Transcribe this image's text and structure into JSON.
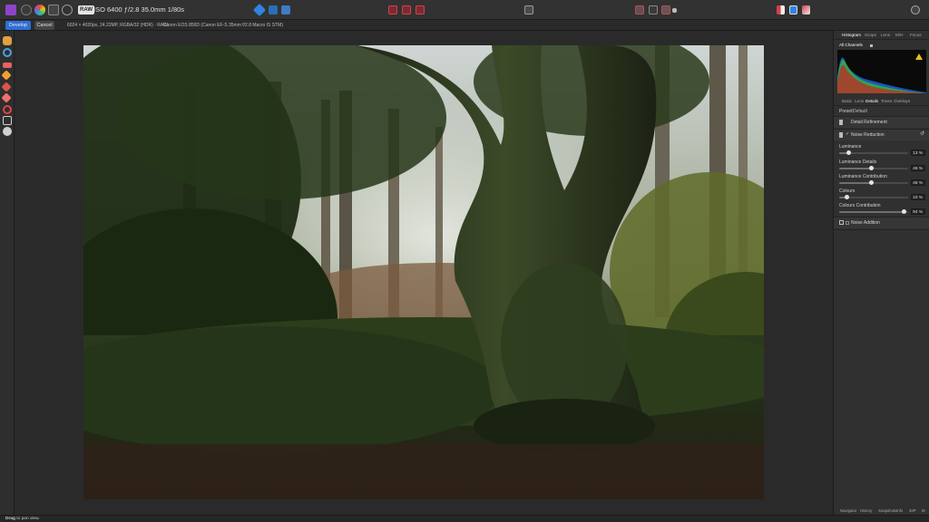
{
  "toolbar": {
    "raw_badge": "RAW",
    "exif": "ISO 6400 ƒ/2.8 35.0mm 1/80s",
    "colors": {
      "persona_develop": "#8e44c9",
      "accent_blue": "#2f84e0",
      "accent_red": "#d6404a"
    }
  },
  "context": {
    "develop_label": "Develop",
    "cancel_label": "Cancel",
    "image_info": "6024 × 4020px, 24.22MP, RGBA/32 (HDR) · RAW",
    "camera_info": "Canon EOS 850D (Canon EF-S 35mm f/2.8 Macro IS STM)"
  },
  "panel": {
    "top_tabs": [
      "Histogram",
      "Scope",
      "Lens",
      "M/H",
      "Focus"
    ],
    "channels": "All Channels",
    "sub_tabs": [
      "Basic",
      "Lens",
      "Details",
      "Tones",
      "Overlays"
    ],
    "preset_label": "Preset:",
    "preset_value": "Default",
    "detail_refinement": "Detail Refinement",
    "noise_reduction": "Noise Reduction",
    "sliders": [
      {
        "label": "Luminance",
        "value_text": "13 %",
        "value": 13
      },
      {
        "label": "Luminance Details",
        "value_text": "46 %",
        "value": 46
      },
      {
        "label": "Luminance Contribution",
        "value_text": "46 %",
        "value": 46
      },
      {
        "label": "Colours",
        "value_text": "10 %",
        "value": 10
      },
      {
        "label": "Colours Contribution",
        "value_text": "94 %",
        "value": 94
      }
    ],
    "noise_addition": "Noise Addition",
    "bottom_tabs": [
      "Navigator",
      "History",
      "Snapshots",
      "Info",
      "32P",
      "M"
    ]
  },
  "status": {
    "bold": "Drag",
    "rest": " to pan view."
  }
}
